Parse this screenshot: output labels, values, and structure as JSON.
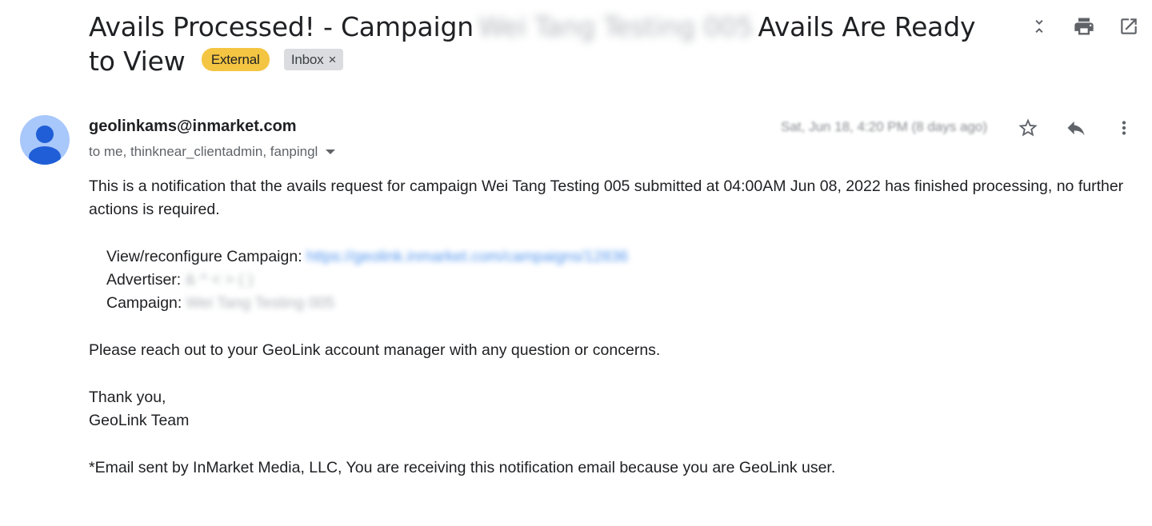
{
  "subject": {
    "part1": "Avails Processed! - Campaign",
    "redacted": "Wei Tang Testing 005",
    "part2": "Avails Are Ready to View",
    "labels": {
      "external": "External",
      "inbox": "Inbox",
      "inbox_remove": "×"
    }
  },
  "toolbar": {
    "icons": [
      "collapse-all-icon",
      "print-icon",
      "open-in-new-window-icon"
    ]
  },
  "message": {
    "sender_email": "geolinkams@inmarket.com",
    "recipients": "to me, thinknear_clientadmin, fanpingl",
    "date": "Sat, Jun 18, 4:20 PM (8 days ago)",
    "action_icons": [
      "star-icon",
      "reply-icon",
      "more-vert-icon"
    ]
  },
  "body": {
    "intro": "This is a notification that the avails request for campaign Wei Tang Testing 005 submitted at 04:00AM Jun 08, 2022 has finished processing, no further actions is required.",
    "details": {
      "view_label": "View/reconfigure Campaign:",
      "view_link": "https://geolink.inmarket.com/campaigns/12836",
      "advertiser_label": "Advertiser:",
      "advertiser_value": "& ^ < > ( )",
      "campaign_label": "Campaign:",
      "campaign_value": "Wei Tang Testing 005"
    },
    "reach_out": "Please reach out to your GeoLink account manager with any question or concerns.",
    "thanks": "Thank you,",
    "team": "GeoLink Team",
    "footer": "*Email sent by InMarket Media, LLC, You are receiving this notification email because you are GeoLink user."
  },
  "colors": {
    "external_label": "#f4c542",
    "inbox_label": "#dadce0",
    "avatar_bg": "#a8c7fa",
    "avatar_fg": "#1f5ed6",
    "link": "#1a73e8"
  }
}
